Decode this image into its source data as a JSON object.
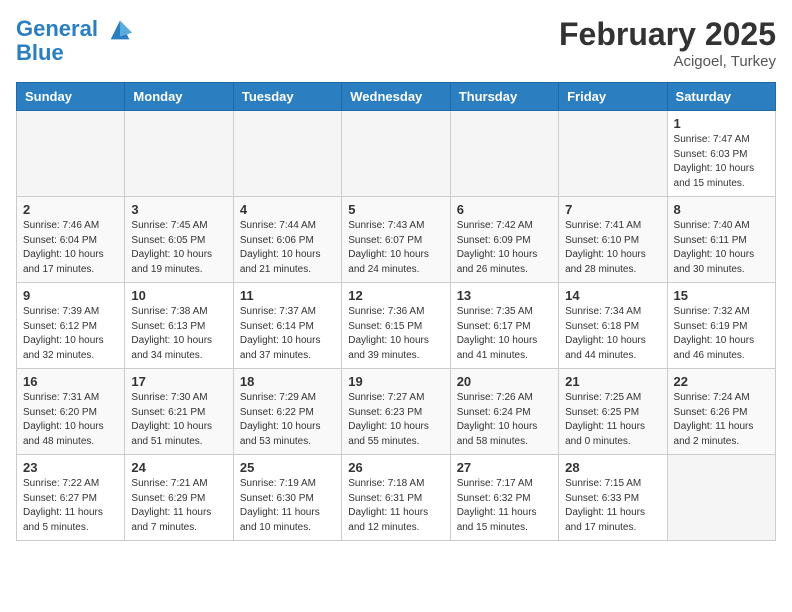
{
  "header": {
    "logo_line1": "General",
    "logo_line2": "Blue",
    "month_title": "February 2025",
    "location": "Acigoel, Turkey"
  },
  "weekdays": [
    "Sunday",
    "Monday",
    "Tuesday",
    "Wednesday",
    "Thursday",
    "Friday",
    "Saturday"
  ],
  "weeks": [
    [
      {
        "day": "",
        "info": ""
      },
      {
        "day": "",
        "info": ""
      },
      {
        "day": "",
        "info": ""
      },
      {
        "day": "",
        "info": ""
      },
      {
        "day": "",
        "info": ""
      },
      {
        "day": "",
        "info": ""
      },
      {
        "day": "1",
        "info": "Sunrise: 7:47 AM\nSunset: 6:03 PM\nDaylight: 10 hours and 15 minutes."
      }
    ],
    [
      {
        "day": "2",
        "info": "Sunrise: 7:46 AM\nSunset: 6:04 PM\nDaylight: 10 hours and 17 minutes."
      },
      {
        "day": "3",
        "info": "Sunrise: 7:45 AM\nSunset: 6:05 PM\nDaylight: 10 hours and 19 minutes."
      },
      {
        "day": "4",
        "info": "Sunrise: 7:44 AM\nSunset: 6:06 PM\nDaylight: 10 hours and 21 minutes."
      },
      {
        "day": "5",
        "info": "Sunrise: 7:43 AM\nSunset: 6:07 PM\nDaylight: 10 hours and 24 minutes."
      },
      {
        "day": "6",
        "info": "Sunrise: 7:42 AM\nSunset: 6:09 PM\nDaylight: 10 hours and 26 minutes."
      },
      {
        "day": "7",
        "info": "Sunrise: 7:41 AM\nSunset: 6:10 PM\nDaylight: 10 hours and 28 minutes."
      },
      {
        "day": "8",
        "info": "Sunrise: 7:40 AM\nSunset: 6:11 PM\nDaylight: 10 hours and 30 minutes."
      }
    ],
    [
      {
        "day": "9",
        "info": "Sunrise: 7:39 AM\nSunset: 6:12 PM\nDaylight: 10 hours and 32 minutes."
      },
      {
        "day": "10",
        "info": "Sunrise: 7:38 AM\nSunset: 6:13 PM\nDaylight: 10 hours and 34 minutes."
      },
      {
        "day": "11",
        "info": "Sunrise: 7:37 AM\nSunset: 6:14 PM\nDaylight: 10 hours and 37 minutes."
      },
      {
        "day": "12",
        "info": "Sunrise: 7:36 AM\nSunset: 6:15 PM\nDaylight: 10 hours and 39 minutes."
      },
      {
        "day": "13",
        "info": "Sunrise: 7:35 AM\nSunset: 6:17 PM\nDaylight: 10 hours and 41 minutes."
      },
      {
        "day": "14",
        "info": "Sunrise: 7:34 AM\nSunset: 6:18 PM\nDaylight: 10 hours and 44 minutes."
      },
      {
        "day": "15",
        "info": "Sunrise: 7:32 AM\nSunset: 6:19 PM\nDaylight: 10 hours and 46 minutes."
      }
    ],
    [
      {
        "day": "16",
        "info": "Sunrise: 7:31 AM\nSunset: 6:20 PM\nDaylight: 10 hours and 48 minutes."
      },
      {
        "day": "17",
        "info": "Sunrise: 7:30 AM\nSunset: 6:21 PM\nDaylight: 10 hours and 51 minutes."
      },
      {
        "day": "18",
        "info": "Sunrise: 7:29 AM\nSunset: 6:22 PM\nDaylight: 10 hours and 53 minutes."
      },
      {
        "day": "19",
        "info": "Sunrise: 7:27 AM\nSunset: 6:23 PM\nDaylight: 10 hours and 55 minutes."
      },
      {
        "day": "20",
        "info": "Sunrise: 7:26 AM\nSunset: 6:24 PM\nDaylight: 10 hours and 58 minutes."
      },
      {
        "day": "21",
        "info": "Sunrise: 7:25 AM\nSunset: 6:25 PM\nDaylight: 11 hours and 0 minutes."
      },
      {
        "day": "22",
        "info": "Sunrise: 7:24 AM\nSunset: 6:26 PM\nDaylight: 11 hours and 2 minutes."
      }
    ],
    [
      {
        "day": "23",
        "info": "Sunrise: 7:22 AM\nSunset: 6:27 PM\nDaylight: 11 hours and 5 minutes."
      },
      {
        "day": "24",
        "info": "Sunrise: 7:21 AM\nSunset: 6:29 PM\nDaylight: 11 hours and 7 minutes."
      },
      {
        "day": "25",
        "info": "Sunrise: 7:19 AM\nSunset: 6:30 PM\nDaylight: 11 hours and 10 minutes."
      },
      {
        "day": "26",
        "info": "Sunrise: 7:18 AM\nSunset: 6:31 PM\nDaylight: 11 hours and 12 minutes."
      },
      {
        "day": "27",
        "info": "Sunrise: 7:17 AM\nSunset: 6:32 PM\nDaylight: 11 hours and 15 minutes."
      },
      {
        "day": "28",
        "info": "Sunrise: 7:15 AM\nSunset: 6:33 PM\nDaylight: 11 hours and 17 minutes."
      },
      {
        "day": "",
        "info": ""
      }
    ]
  ]
}
